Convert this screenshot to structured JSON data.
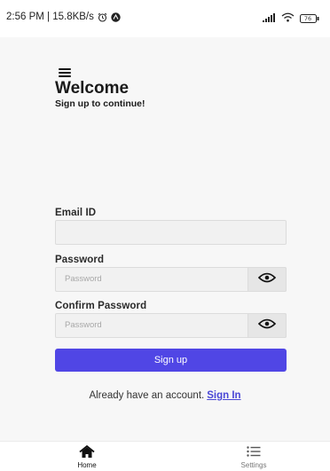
{
  "status_bar": {
    "time_speed": "2:56 PM | 15.8KB/s",
    "alarm_icon": "alarm-clock-icon",
    "app_icon": "notification-app-icon",
    "signal_icon": "cell-signal-icon",
    "wifi_icon": "wifi-icon",
    "battery_icon": "battery-icon",
    "battery_level": "76"
  },
  "header": {
    "menu_icon": "hamburger-menu-icon",
    "title": "Welcome",
    "subtitle": "Sign up to continue!"
  },
  "form": {
    "email": {
      "label": "Email ID",
      "value": "",
      "placeholder": ""
    },
    "password": {
      "label": "Password",
      "value": "",
      "placeholder": "Password",
      "toggle_icon": "eye-icon"
    },
    "confirm_password": {
      "label": "Confirm Password",
      "value": "",
      "placeholder": "Password",
      "toggle_icon": "eye-icon"
    },
    "submit_label": "Sign up",
    "accent_color": "#5046e5"
  },
  "footer": {
    "prompt": "Already have an account.",
    "link_label": "Sign In"
  },
  "bottom_nav": {
    "items": [
      {
        "label": "Home",
        "icon": "home-icon",
        "active": true
      },
      {
        "label": "Settings",
        "icon": "list-settings-icon",
        "active": false
      }
    ]
  }
}
